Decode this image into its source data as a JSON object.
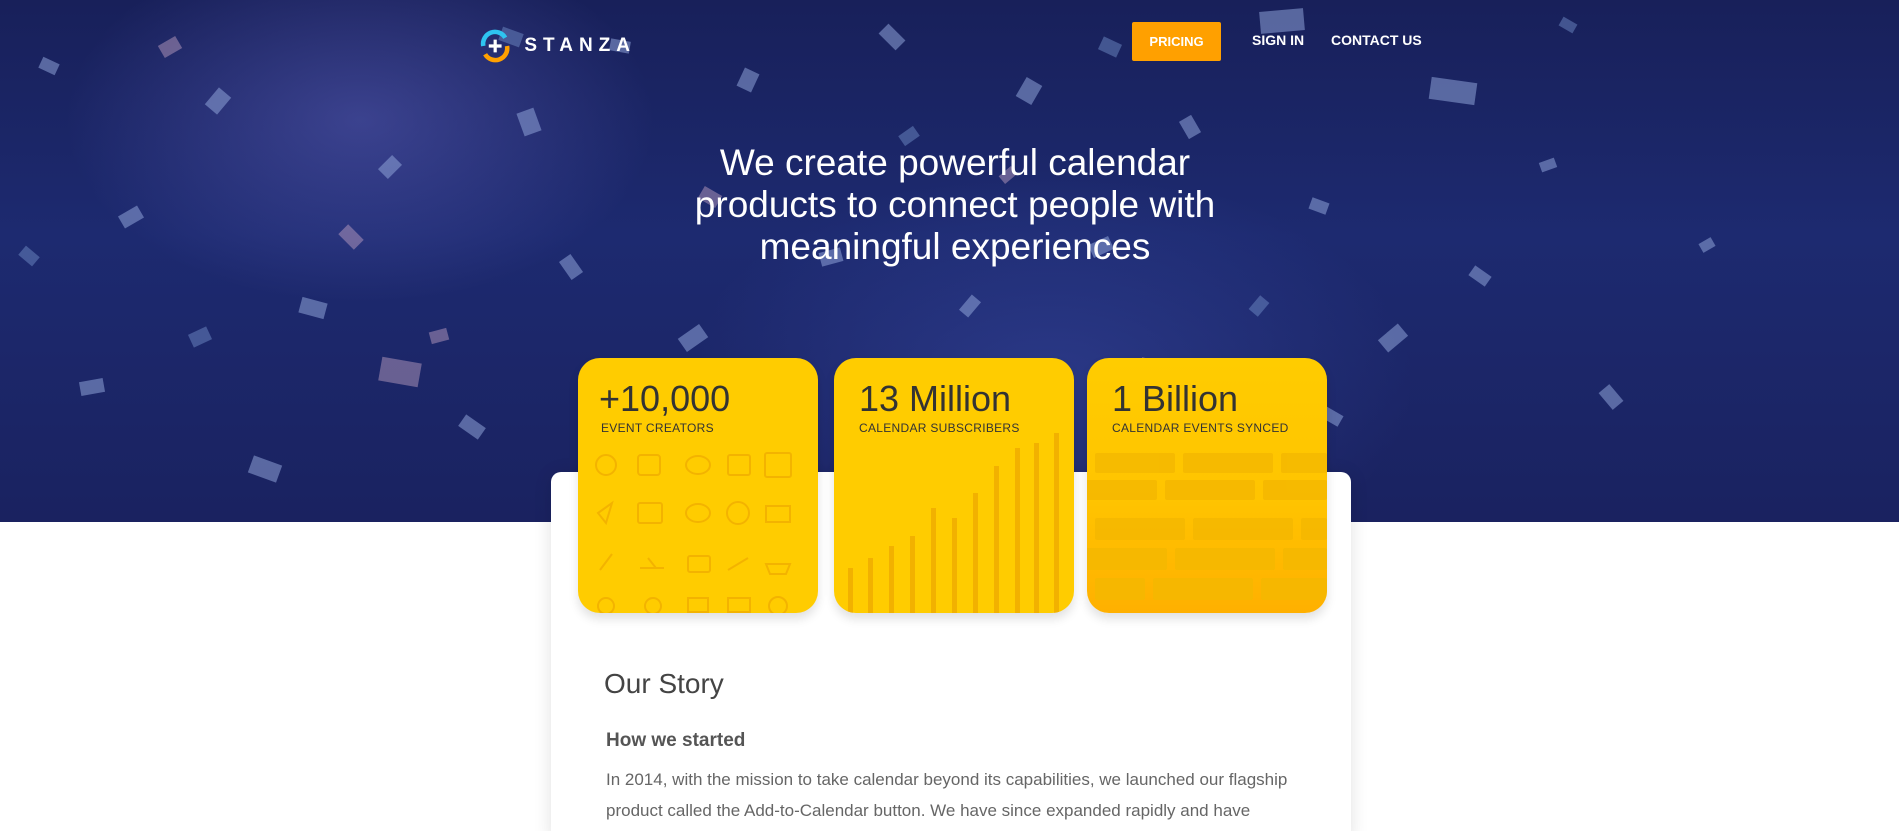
{
  "brand": {
    "name": "STANZA"
  },
  "nav": {
    "pricing_label": "PRICING",
    "signin_label": "SIGN IN",
    "contact_label": "CONTACT US"
  },
  "hero": {
    "headline_line1": "We create powerful calendar",
    "headline_line2": "products to connect people with",
    "headline_line3": "meaningful experiences"
  },
  "stats": [
    {
      "value": "+10,000",
      "label": "EVENT CREATORS"
    },
    {
      "value": "13 Million",
      "label": "CALENDAR SUBSCRIBERS"
    },
    {
      "value": "1 Billion",
      "label": "CALENDAR EVENTS SYNCED"
    }
  ],
  "story": {
    "title": "Our Story",
    "subtitle": "How we started",
    "paragraph_line1": "In 2014, with the mission to take calendar beyond its capabilities, we launched our flagship",
    "paragraph_line2": "product called the Add-to-Calendar button. We have since expanded rapidly and have"
  },
  "colors": {
    "accent": "#ffa000",
    "card": "#ffcc00",
    "hero_bg": "#1d2a70"
  },
  "icons": [
    "logo-icon",
    "event-category-icons",
    "subscriber-growth-bars",
    "synced-events-grid"
  ]
}
